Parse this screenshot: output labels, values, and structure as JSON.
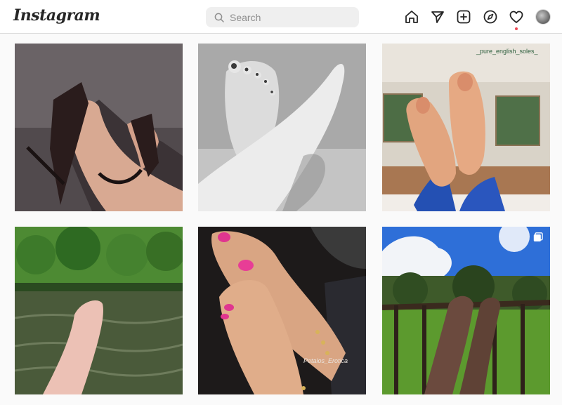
{
  "app": {
    "logo": "Instagram"
  },
  "search": {
    "placeholder": "Search"
  },
  "nav": {
    "icons": [
      "home-icon",
      "direct-icon",
      "new-post-icon",
      "explore-icon",
      "activity-icon"
    ],
    "notification_color": "#ed4956"
  },
  "grid": {
    "posts": [
      {
        "subject": "feet in black high-heel sandals"
      },
      {
        "subject": "black and white bare feet"
      },
      {
        "subject": "soles of feet",
        "watermark": "_pure_english_soles_"
      },
      {
        "subject": "foot over river"
      },
      {
        "subject": "feet with pink polish and anklet",
        "watermark": "Petalos_Erotica"
      },
      {
        "subject": "feet against blue sky",
        "multi_photo": true
      }
    ]
  }
}
